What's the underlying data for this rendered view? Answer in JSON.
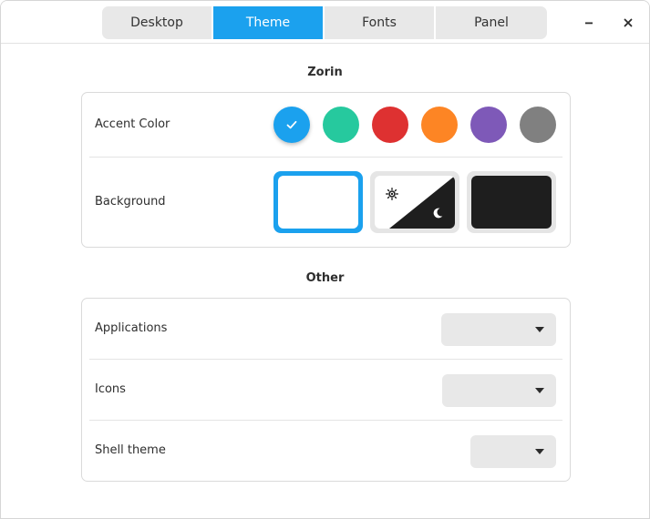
{
  "tabs": [
    {
      "label": "Desktop",
      "active": false
    },
    {
      "label": "Theme",
      "active": true
    },
    {
      "label": "Fonts",
      "active": false
    },
    {
      "label": "Panel",
      "active": false
    }
  ],
  "window_controls": {
    "minimize": "minimize-icon",
    "close": "close-icon"
  },
  "sections": {
    "zorin": {
      "title": "Zorin"
    },
    "other": {
      "title": "Other"
    }
  },
  "accent": {
    "label": "Accent Color",
    "colors": [
      {
        "name": "blue",
        "hex": "#1ba1ee",
        "selected": true
      },
      {
        "name": "green",
        "hex": "#26c99e",
        "selected": false
      },
      {
        "name": "red",
        "hex": "#de3131",
        "selected": false
      },
      {
        "name": "orange",
        "hex": "#fd8524",
        "selected": false
      },
      {
        "name": "purple",
        "hex": "#7e59b8",
        "selected": false
      },
      {
        "name": "gray",
        "hex": "#808080",
        "selected": false
      }
    ]
  },
  "background": {
    "label": "Background",
    "options": [
      {
        "name": "light",
        "selected": true
      },
      {
        "name": "auto",
        "selected": false,
        "icons": [
          "sun-icon",
          "moon-icon"
        ]
      },
      {
        "name": "dark",
        "selected": false
      }
    ]
  },
  "other": {
    "applications": {
      "label": "Applications",
      "value": ""
    },
    "icons": {
      "label": "Icons",
      "value": ""
    },
    "shell_theme": {
      "label": "Shell theme",
      "value": ""
    }
  },
  "colors": {
    "accent": "#1ba1ee",
    "tab_bg": "#e8e8e8",
    "card_border": "#dadada",
    "dark_bg": "#1e1e1e"
  }
}
